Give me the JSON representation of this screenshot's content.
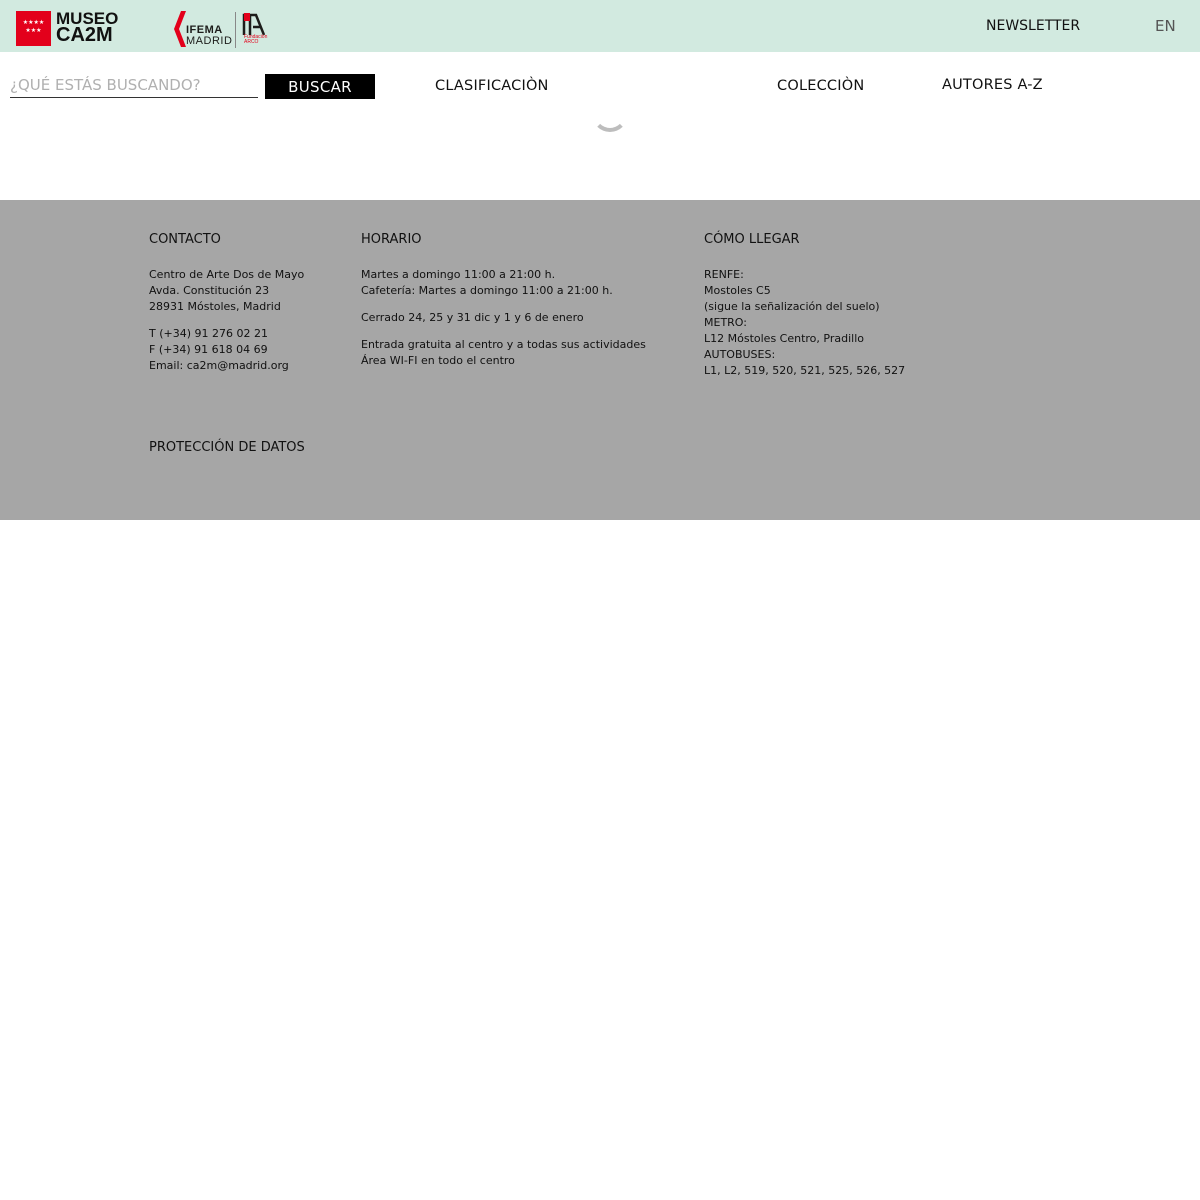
{
  "header": {
    "logo_madrid_stars": "★★★★ ★★★",
    "logo_museo_line1": "MUSEO",
    "logo_museo_line2": "CA2M",
    "logo_ifema_line1": "IFEMA",
    "logo_ifema_line2": "MADRID",
    "logo_arco_sub": "Fundación ARCO",
    "newsletter_label": "NEWSLETTER",
    "language_label": "EN"
  },
  "search": {
    "placeholder": "¿QUÉ ESTÁS BUSCANDO?",
    "value": "",
    "button_label": "BUSCAR"
  },
  "nav": {
    "clasificacion": "CLASIFICACIÒN",
    "coleccion": "COLECCIÒN",
    "autores": "AUTORES A-Z"
  },
  "footer": {
    "contacto": {
      "title": "CONTACTO",
      "address": [
        "Centro de Arte Dos de Mayo",
        "Avda. Constitución 23",
        "28931 Móstoles, Madrid"
      ],
      "phone": "T (+34) 91 276 02 21",
      "fax": "F (+34) 91 618 04 69",
      "email": "Email: ca2m@madrid.org"
    },
    "horario": {
      "title": "HORARIO",
      "lines": [
        "Martes a domingo 11:00 a 21:00 h.",
        "Cafetería: Martes a domingo 11:00 a 21:00 h."
      ],
      "closed": "Cerrado 24, 25 y 31 dic y 1 y 6 de enero",
      "extra": [
        "Entrada gratuita al centro y a todas sus actividades",
        "Área WI-FI en todo el centro"
      ]
    },
    "como_llegar": {
      "title": "CÓMO LLEGAR",
      "lines": [
        "RENFE:",
        "Mostoles C5",
        "(sigue la señalización del suelo)",
        "METRO:",
        "L12 Móstoles Centro, Pradillo",
        "AUTOBUSES:",
        "L1, L2, 519, 520, 521, 525, 526, 527"
      ]
    },
    "legal_link": "PROTECCIÓN DE DATOS"
  },
  "colors": {
    "topbar": "#d2eae0",
    "footer": "#a6a6a6",
    "madrid_red": "#e3001b"
  }
}
